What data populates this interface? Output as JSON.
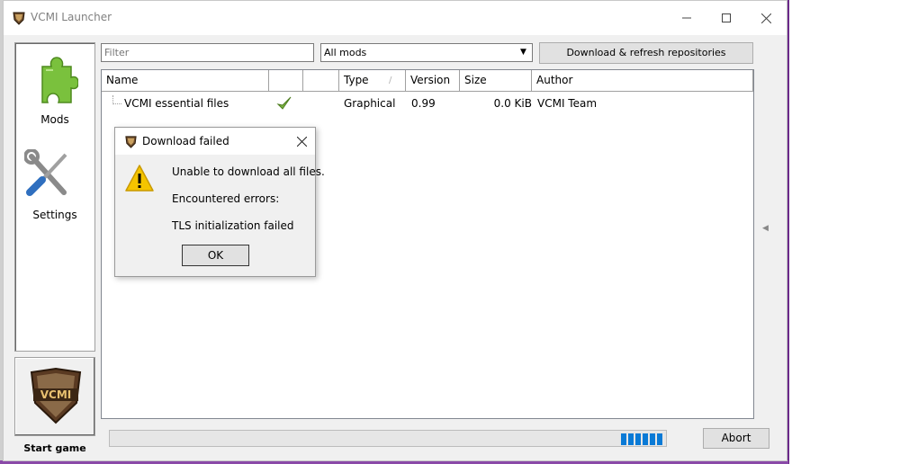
{
  "window": {
    "title": "VCMI Launcher"
  },
  "sidebar": {
    "items": [
      {
        "label": "Mods",
        "icon": "puzzle-icon"
      },
      {
        "label": "Settings",
        "icon": "wrench-screwdriver-icon"
      }
    ],
    "start_game_label": "Start game",
    "logo_text": "VCMI"
  },
  "toolbar": {
    "filter_placeholder": "Filter",
    "mods_select_value": "All mods",
    "refresh_label": "Download & refresh repositories"
  },
  "table": {
    "columns": [
      "Name",
      "",
      "",
      "Type",
      "Version",
      "Size",
      "Author"
    ],
    "rows": [
      {
        "name": "VCMI essential files",
        "enabled": true,
        "type": "Graphical",
        "version": "0.99",
        "size": "0.0 KiB",
        "author": "VCMI Team"
      }
    ]
  },
  "progress": {
    "fraction": 0.08
  },
  "abort_label": "Abort",
  "dialog": {
    "title": "Download failed",
    "line1": "Unable to download all files.",
    "line2": "Encountered errors:",
    "line3": "TLS initialization failed",
    "ok_label": "OK",
    "icon": "warning-icon"
  },
  "colors": {
    "progress": "#0a7ad6",
    "checkmark": "#7cb342",
    "warning": "#f5c400",
    "puzzle": "#7ac13d"
  }
}
